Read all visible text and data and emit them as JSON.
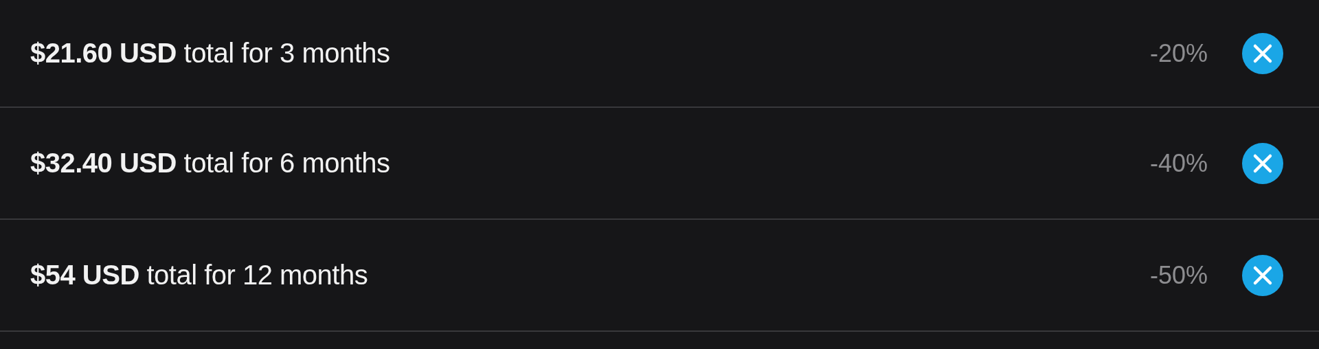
{
  "bundles": [
    {
      "text": "**$21.60 USD** total for 3 months",
      "discount": "-20%"
    },
    {
      "text": "**$32.40 USD** total for 6 months",
      "discount": "-40%"
    },
    {
      "text": "**$54 USD** total for 12 months",
      "discount": "-50%"
    }
  ]
}
